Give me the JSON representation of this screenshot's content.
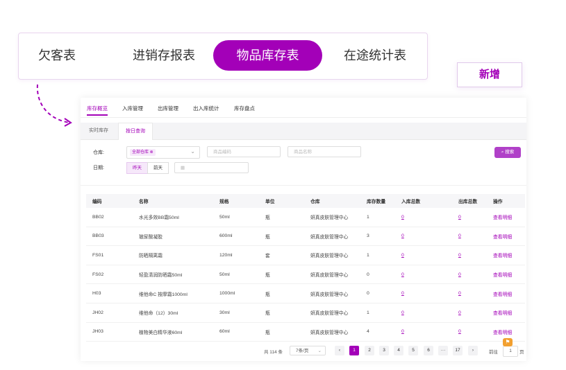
{
  "top_tabs": [
    {
      "label": "欠客表",
      "active": false
    },
    {
      "label": "进销存报表",
      "active": false
    },
    {
      "label": "物品库存表",
      "active": true
    },
    {
      "label": "在途统计表",
      "active": false
    }
  ],
  "new_button": "新增",
  "subnav": [
    "库存概览",
    "入库管理",
    "出库管理",
    "出入库统计",
    "库存盘点"
  ],
  "inner_tabs": [
    "实时库存",
    "按日查询"
  ],
  "filters": {
    "warehouse_label": "仓库:",
    "warehouse_value": "全部仓库",
    "code_placeholder": "商品编码",
    "name_placeholder": "商品名称",
    "search_label": "搜索",
    "date_label": "日期:",
    "date_yesterday": "昨天",
    "date_before": "前天"
  },
  "table": {
    "headers": [
      "编码",
      "名称",
      "规格",
      "单位",
      "仓库",
      "库存数量",
      "入库总数",
      "出库总数",
      "操作"
    ],
    "rows": [
      [
        "BB02",
        "水光多效BB霜50ml",
        "50ml",
        "瓶",
        "妍真皮肤管理中心",
        "1",
        "0",
        "0",
        "查看明细"
      ],
      [
        "BB03",
        "玻尿酸凝胶",
        "600ml",
        "瓶",
        "妍真皮肤管理中心",
        "3",
        "0",
        "0",
        "查看明细"
      ],
      [
        "FS01",
        "防晒隔离霜",
        "120ml",
        "套",
        "妍真皮肤管理中心",
        "1",
        "0",
        "0",
        "查看明细"
      ],
      [
        "FS02",
        "轻盈清润防晒霜50ml",
        "50ml",
        "瓶",
        "妍真皮肤管理中心",
        "0",
        "0",
        "0",
        "查看明细"
      ],
      [
        "H03",
        "维他命C 按摩霜1000ml",
        "1000ml",
        "瓶",
        "妍真皮肤管理中心",
        "0",
        "0",
        "0",
        "查看明细"
      ],
      [
        "JH02",
        "维他命（12）30ml",
        "30ml",
        "瓶",
        "妍真皮肤管理中心",
        "1",
        "0",
        "0",
        "查看明细"
      ],
      [
        "JH03",
        "植物美白精华液60ml",
        "60ml",
        "瓶",
        "妍真皮肤管理中心",
        "4",
        "0",
        "0",
        "查看明细"
      ]
    ]
  },
  "pagination": {
    "total": "共 114 条",
    "page_size": "7条/页",
    "prev": "‹",
    "pages": [
      "1",
      "2",
      "3",
      "4",
      "5",
      "6",
      "···",
      "17"
    ],
    "next": "›",
    "goto_label": "前往",
    "goto_value": "1",
    "page_suffix": "页"
  },
  "colors": {
    "accent": "#a300b8"
  }
}
